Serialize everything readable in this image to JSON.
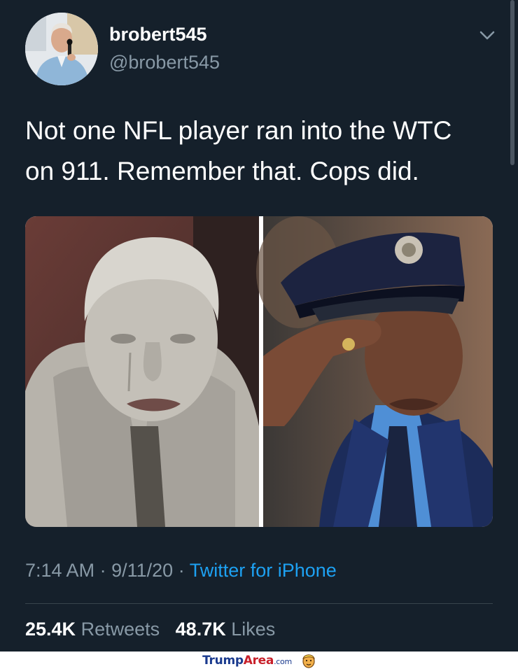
{
  "tweet": {
    "display_name": "brobert545",
    "handle": "@brobert545",
    "text": "Not one NFL player ran into the WTC\non 911. Remember that. Cops did.",
    "time": "7:14 AM",
    "date": "9/11/20",
    "source": "Twitter for iPhone",
    "retweets_count": "25.4K",
    "retweets_label": "Retweets",
    "likes_count": "48.7K",
    "likes_label": "Likes"
  },
  "watermark": {
    "part1": "Trump",
    "part2": "Area",
    "tld": ".com"
  },
  "colors": {
    "background": "#15202b",
    "secondary_text": "#8899a6",
    "link": "#1da1f2"
  },
  "icons": [
    "chevron-down-icon",
    "trump-face-icon"
  ]
}
